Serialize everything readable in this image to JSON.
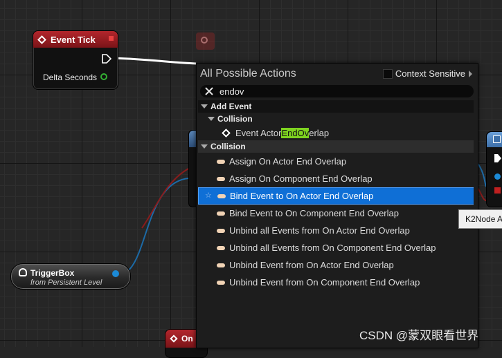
{
  "event_tick_node": {
    "title": "Event Tick",
    "pin_label": "Delta Seconds"
  },
  "triggerbox_node": {
    "title": "TriggerBox",
    "subtitle": "from Persistent Level"
  },
  "bottom_node": {
    "title": "On"
  },
  "action_menu": {
    "title": "All Possible Actions",
    "context_sensitive_label": "Context Sensitive",
    "context_sensitive_checked": false,
    "search_value": "endov",
    "categories": [
      {
        "label": "Add Event",
        "subcategories": [
          {
            "label": "Collision",
            "items": [
              {
                "prefix": "Event Actor",
                "match": "EndOv",
                "suffix": "erlap"
              }
            ]
          }
        ]
      },
      {
        "label": "Collision",
        "items": [
          "Assign On Actor End Overlap",
          "Assign On Component End Overlap",
          "Bind Event to On Actor End Overlap",
          "Bind Event to On Component End Overlap",
          "Unbind all Events from On Actor End Overlap",
          "Unbind all Events from On Component End Overlap",
          "Unbind Event from On Actor End Overlap",
          "Unbind Event from On Component End Overlap"
        ],
        "selected_index": 2
      }
    ]
  },
  "tooltip": {
    "text": "K2Node A"
  },
  "watermark": "CSDN @蒙双眼看世界",
  "colors": {
    "event_header": "#b3262c",
    "selection": "#0f6fd6",
    "match_highlight": "#7ed320",
    "float_pin": "#33b033",
    "object_pin": "#1c8ad6"
  }
}
